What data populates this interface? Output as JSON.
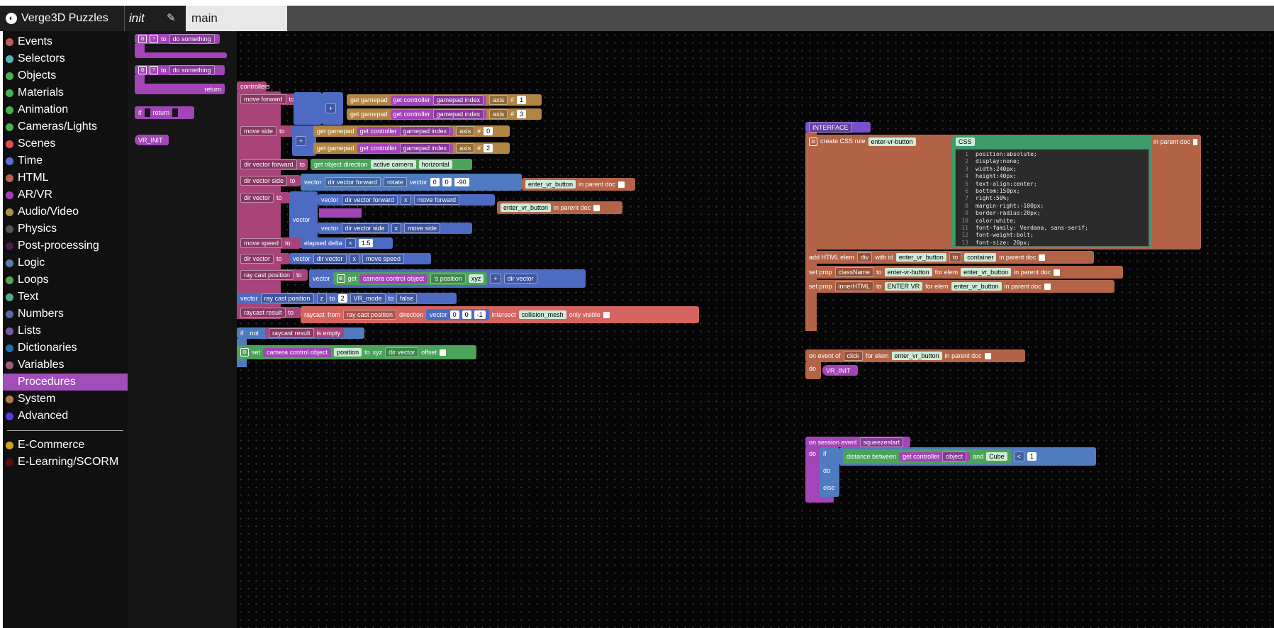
{
  "app": {
    "title": "Verge3D Puzzles",
    "logo": "V3D"
  },
  "tabs": [
    {
      "label": "init"
    },
    {
      "label": "main"
    }
  ],
  "icons": {
    "pin": "pin-icon",
    "brand": "verge3d-logo-icon"
  },
  "toolbox": {
    "categories": [
      {
        "label": "Events",
        "color": "#c35b5b"
      },
      {
        "label": "Selectors",
        "color": "#4fb2b2"
      },
      {
        "label": "Objects",
        "color": "#4caf50"
      },
      {
        "label": "Materials",
        "color": "#4caf50"
      },
      {
        "label": "Animation",
        "color": "#4caf50"
      },
      {
        "label": "Cameras/Lights",
        "color": "#4caf50"
      },
      {
        "label": "Scenes",
        "color": "#e05050"
      },
      {
        "label": "Time",
        "color": "#5b6fd6"
      },
      {
        "label": "HTML",
        "color": "#b5654d"
      },
      {
        "label": "AR/VR",
        "color": "#a83dba"
      },
      {
        "label": "Audio/Video",
        "color": "#a8954a"
      },
      {
        "label": "Physics",
        "color": "#555555"
      },
      {
        "label": "Post-processing",
        "color": "#4b1f4b"
      },
      {
        "label": "Logic",
        "color": "#5b80a5"
      },
      {
        "label": "Loops",
        "color": "#5ba55b"
      },
      {
        "label": "Text",
        "color": "#5ba58c"
      },
      {
        "label": "Numbers",
        "color": "#5b67a5"
      },
      {
        "label": "Lists",
        "color": "#745ba5"
      },
      {
        "label": "Dictionaries",
        "color": "#2a6ea8"
      },
      {
        "label": "Variables",
        "color": "#a55b80"
      },
      {
        "label": "Procedures",
        "color": "#a24db9",
        "selected": true
      },
      {
        "label": "System",
        "color": "#b77a4a"
      },
      {
        "label": "Advanced",
        "color": "#5040e0"
      }
    ],
    "extra_categories": [
      {
        "label": "E-Commerce",
        "color": "#d4a017"
      },
      {
        "label": "E-Learning/SCORM",
        "color": "#5a1010"
      }
    ]
  },
  "flyout": {
    "proc1": {
      "prefix": "to",
      "name": "do something"
    },
    "proc2": {
      "prefix": "to",
      "name": "do something",
      "suffix": "return"
    },
    "ifreturn": {
      "if": "if",
      "return": "return"
    },
    "call": "VR_INIT"
  },
  "blocks": {
    "controllers": "controllers",
    "to": "to",
    "get_gamepad": "get gamepad",
    "get_controller": "get controller",
    "gamepad_index": "gamepad index",
    "axis": "axis",
    "hash": "#",
    "n1": "1",
    "n3": "3",
    "n0": "0",
    "n2": "2",
    "move_forward": "move forward",
    "move_side": "move side",
    "minus": "-",
    "plus": "+",
    "dir_vector_forward": "dir vector forward",
    "dir_vector_side": "dir vector side",
    "dir_vector": "dir vector",
    "get_object_direction": "get object direction",
    "active_camera": "active camera",
    "horizontal": "horizontal",
    "vector": "vector",
    "rotate": "rotate",
    "v0": "0",
    "vm90": "-90",
    "x": "x",
    "enter_vr_button": "enter_vr_button",
    "in_parent_doc": "in parent doc",
    "move_speed": "move speed",
    "elapsed_delta": "elapsed delta",
    "times": "×",
    "v15": "1.5",
    "ray_cast_position": "ray cast position",
    "get": "get",
    "camera_control_object": "camera control object",
    "s_position": "'s position",
    "xyz": "xyz",
    "z": "z",
    "vr_mode": "VR_mode",
    "false": "false",
    "raycast_result": "raycast result",
    "raycast": "raycast",
    "from": "from",
    "direction": "direction",
    "vm1": "-1",
    "intersect": "intersect",
    "collision_mesh": "collision_mesh",
    "only_visible": "only visible",
    "if": "if",
    "not": "not",
    "is_empty": "is empty",
    "set": "set",
    "position": "position",
    "offset": "offset",
    "interface": "INTERFACE",
    "create_css_rule": "create CSS rule",
    "enter_vr_button_dash": "enter-vr-button",
    "css": "CSS",
    "add_html_elem": "add HTML elem",
    "div": "div",
    "with_id": "with id",
    "container": "container",
    "set_prop": "set prop",
    "classname": "className",
    "for_elem": "for elem",
    "innerhtml": "innerHTML",
    "enter_vr_text": "ENTER VR",
    "on_event_of": "on event of",
    "click": "click",
    "do": "do",
    "vr_init": "VR_INIT",
    "on_session_event": "on session event",
    "squeezestart": "squeezestart",
    "distance_between": "distance between",
    "object": "object",
    "and": "and",
    "cube": "Cube",
    "lt": "<",
    "else": "else"
  },
  "css_code": [
    {
      "n": "1",
      "text": "position:absolute;"
    },
    {
      "n": "2",
      "text": "display:none;"
    },
    {
      "n": "3",
      "text": "width:240px;"
    },
    {
      "n": "4",
      "text": "height:40px;"
    },
    {
      "n": "5",
      "text": "text-align:center;"
    },
    {
      "n": "6",
      "text": "bottom:150px;"
    },
    {
      "n": "7",
      "text": "right:50%;"
    },
    {
      "n": "8",
      "text": "margin-right:-100px;"
    },
    {
      "n": "9",
      "text": "border-radius:20px;"
    },
    {
      "n": "10",
      "text": "color:white;"
    },
    {
      "n": "11",
      "text": "font-family: Verdana, sans-serif;"
    },
    {
      "n": "12",
      "text": "font-weight:bolt;"
    },
    {
      "n": "13",
      "text": "font-size: 20px;"
    }
  ]
}
